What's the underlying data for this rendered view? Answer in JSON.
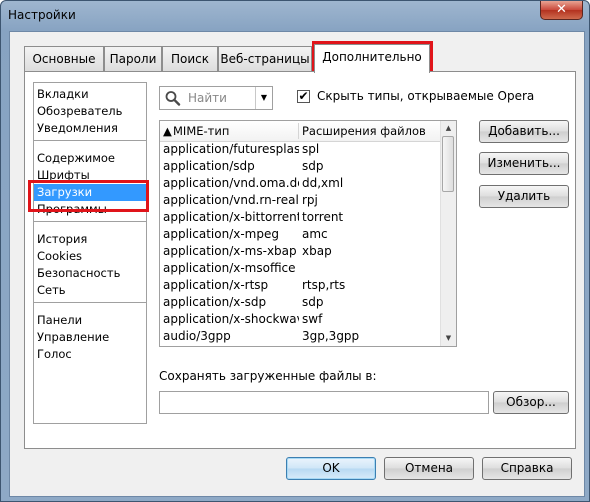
{
  "window": {
    "title": "Настройки",
    "close_glyph": "✕"
  },
  "tabs": [
    {
      "label": "Основные"
    },
    {
      "label": "Пароли"
    },
    {
      "label": "Поиск"
    },
    {
      "label": "Веб-страницы"
    },
    {
      "label": "Дополнительно",
      "active": true
    }
  ],
  "sidebar": {
    "groups": [
      [
        "Вкладки",
        "Обозреватель",
        "Уведомления"
      ],
      [
        "Содержимое",
        "Шрифты",
        "Загрузки",
        "Программы"
      ],
      [
        "История",
        "Cookies",
        "Безопасность",
        "Сеть"
      ],
      [
        "Панели",
        "Управление",
        "Голос"
      ]
    ],
    "selected": "Загрузки"
  },
  "search": {
    "placeholder": "Найти",
    "icon": "magnifier-icon"
  },
  "filter": {
    "label": "Скрыть типы, открываемые Opera",
    "checked": true
  },
  "table": {
    "columns": [
      "MIME-тип",
      "Расширения файлов"
    ],
    "sort_indicator": "▲",
    "rows": [
      [
        "application/futuresplash",
        "spl"
      ],
      [
        "application/sdp",
        "sdp"
      ],
      [
        "application/vnd.oma.dd...",
        "dd,xml"
      ],
      [
        "application/vnd.rn-realp...",
        "rpj"
      ],
      [
        "application/x-bittorrent",
        "torrent"
      ],
      [
        "application/x-mpeg",
        "amc"
      ],
      [
        "application/x-ms-xbap",
        "xbap"
      ],
      [
        "application/x-msoffice",
        ""
      ],
      [
        "application/x-rtsp",
        "rtsp,rts"
      ],
      [
        "application/x-sdp",
        "sdp"
      ],
      [
        "application/x-shockwav...",
        "swf"
      ],
      [
        "audio/3gpp",
        "3gp,3gpp"
      ]
    ]
  },
  "side_buttons": {
    "add": "Добавить...",
    "edit": "Изменить...",
    "delete": "Удалить"
  },
  "downloads": {
    "save_label": "Сохранять загруженные файлы в:",
    "path_value": "",
    "browse": "Обзор..."
  },
  "footer": {
    "ok": "OK",
    "cancel": "Отмена",
    "help": "Справка"
  },
  "colors": {
    "highlight": "#e0141a",
    "selection": "#3399ff"
  }
}
